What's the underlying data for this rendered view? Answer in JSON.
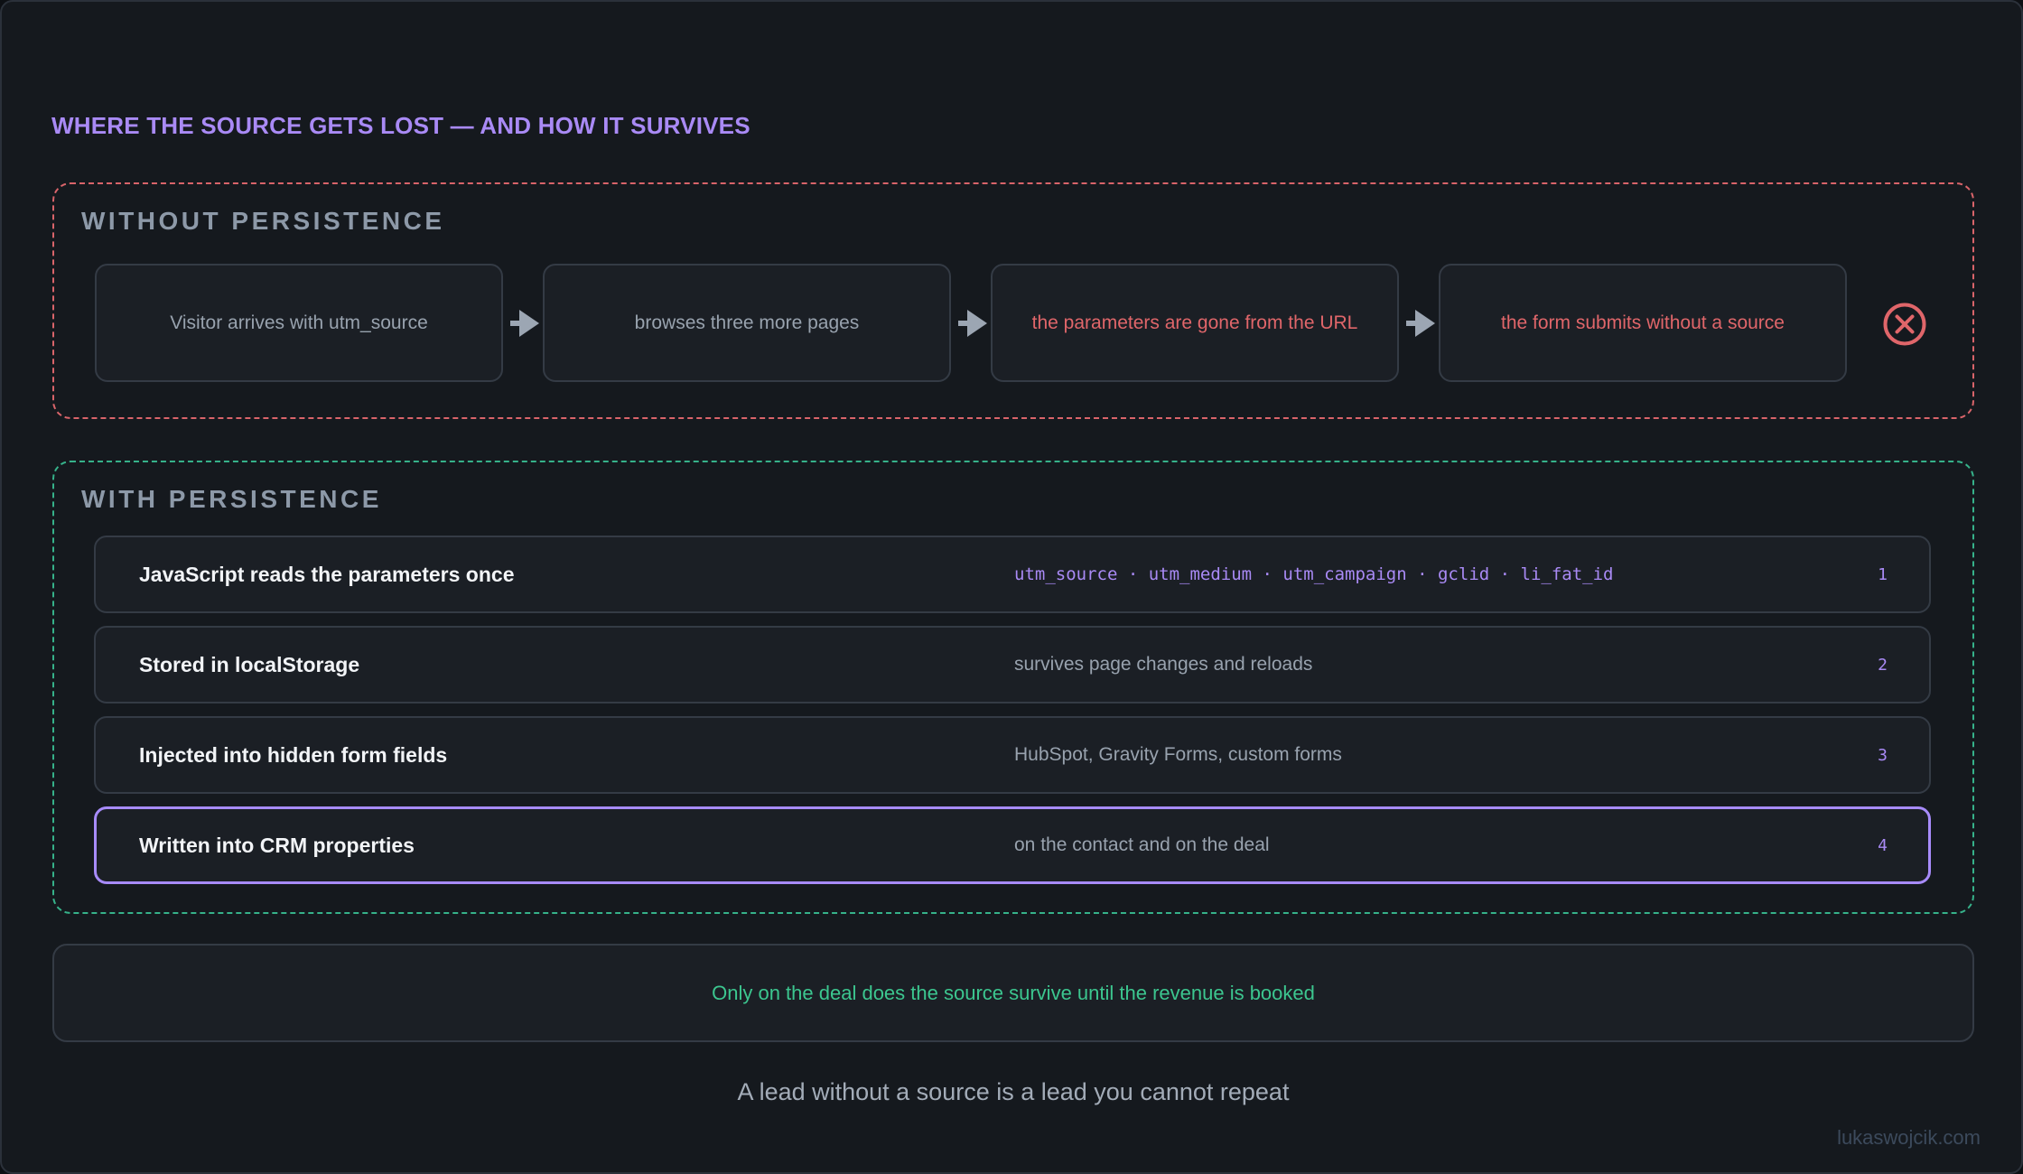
{
  "title": "WHERE THE SOURCE GETS LOST — AND HOW IT SURVIVES",
  "without_persistence": {
    "label": "WITHOUT PERSISTENCE",
    "steps": [
      {
        "text": "Visitor arrives with utm_source",
        "color": "#98a2ae"
      },
      {
        "text": "browses three more pages",
        "color": "#98a2ae"
      },
      {
        "text": "the parameters are gone from the URL",
        "color": "#e0666a"
      },
      {
        "text": "the form submits without a source",
        "color": "#e0666a"
      }
    ],
    "end_icon": "x-circle-icon"
  },
  "with_persistence": {
    "label": "WITH PERSISTENCE",
    "rows": [
      {
        "title": "JavaScript reads the parameters once",
        "detail": "utm_source · utm_medium · utm_campaign · gclid · li_fat_id",
        "number": "1"
      },
      {
        "title": "Stored in localStorage",
        "detail": "survives page changes and reloads",
        "number": "2"
      },
      {
        "title": "Injected into hidden form fields",
        "detail": "HubSpot, Gravity Forms, custom forms",
        "number": "3"
      },
      {
        "title": "Written into CRM properties",
        "detail": "on the contact and on the deal",
        "number": "4"
      }
    ]
  },
  "note": "Only on the deal does the source survive until the revenue is booked",
  "caption": "A lead without a source is a lead you cannot repeat",
  "credit": "lukaswojcik.com",
  "colors": {
    "accent": "#a98af5",
    "danger": "#e0666a",
    "success": "#3cc68f",
    "highlight_border": "#a78bfa"
  }
}
